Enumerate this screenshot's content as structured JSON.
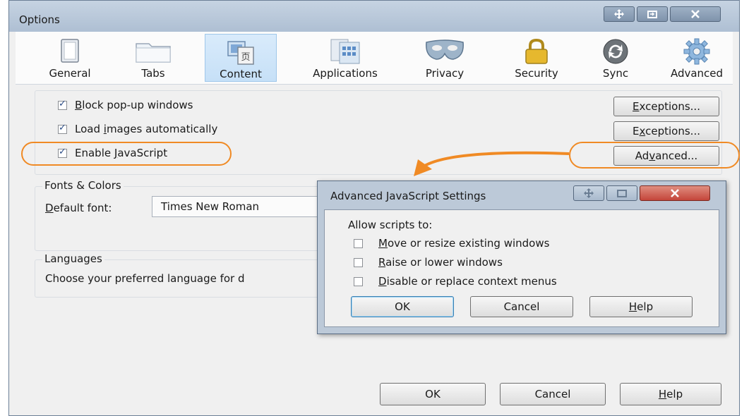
{
  "window": {
    "title": "Options"
  },
  "toolbar": {
    "tabs": [
      {
        "label": "General",
        "icon": "general-icon"
      },
      {
        "label": "Tabs",
        "icon": "tabs-icon"
      },
      {
        "label": "Content",
        "icon": "content-icon"
      },
      {
        "label": "Applications",
        "icon": "applications-icon"
      },
      {
        "label": "Privacy",
        "icon": "privacy-mask-icon"
      },
      {
        "label": "Security",
        "icon": "padlock-icon"
      },
      {
        "label": "Sync",
        "icon": "sync-icon"
      },
      {
        "label": "Advanced",
        "icon": "gear-icon"
      }
    ],
    "selected": "Content"
  },
  "content": {
    "block_popups": {
      "pre": "",
      "key": "B",
      "post": "lock pop-up windows",
      "checked": true
    },
    "load_images": {
      "pre": "Load ",
      "key": "i",
      "post": "mages automatically",
      "checked": true
    },
    "enable_js": {
      "pre": "Enable ",
      "key": "J",
      "post": "avaScript",
      "checked": true
    },
    "exceptions1": {
      "pre": "",
      "key": "E",
      "post": "xceptions..."
    },
    "exceptions2": {
      "pre": "E",
      "key": "x",
      "post": "ceptions..."
    },
    "advanced": {
      "pre": "Ad",
      "key": "v",
      "post": "anced..."
    }
  },
  "fonts": {
    "title": "Fonts & Colors",
    "default_font_label": {
      "pre": "",
      "key": "D",
      "post": "efault font:"
    },
    "default_font_value": "Times New Roman"
  },
  "languages": {
    "title": "Languages",
    "text": "Choose your preferred language for d"
  },
  "dialog": {
    "title": "Advanced JavaScript Settings",
    "allow_label": "Allow scripts to:",
    "options": [
      {
        "pre": "",
        "key": "M",
        "post": "ove or resize existing windows",
        "checked": false
      },
      {
        "pre": "",
        "key": "R",
        "post": "aise or lower windows",
        "checked": false
      },
      {
        "pre": "",
        "key": "D",
        "post": "isable or replace context menus",
        "checked": false
      }
    ],
    "ok": "OK",
    "cancel": "Cancel",
    "help": {
      "pre": "",
      "key": "H",
      "post": "elp"
    }
  },
  "footer": {
    "ok": "OK",
    "cancel": "Cancel",
    "help": {
      "pre": "",
      "key": "H",
      "post": "elp"
    }
  },
  "colors": {
    "annotation": "#f08a24",
    "selected_tab": "#c6e0f7",
    "title_bar": "#b9c9db"
  }
}
